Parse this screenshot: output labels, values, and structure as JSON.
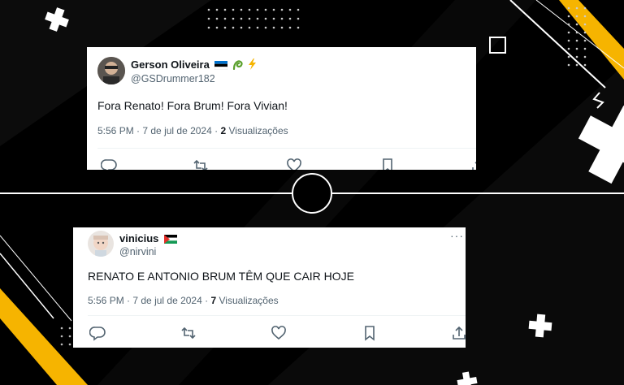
{
  "background": {
    "accent_color": "#f6b400",
    "base_color": "#000000",
    "line_color": "#ffffff"
  },
  "tweets": [
    {
      "author_name": "Gerson Oliveira",
      "author_handle": "@GSDrummer182",
      "author_emojis": [
        "estonia-flag",
        "green-swirl",
        "lightning"
      ],
      "text": "Fora Renato! Fora Brum! Fora Vivian!",
      "time": "5:56 PM",
      "date": "7 de jul de 2024",
      "views_count": "2",
      "views_label": "Visualizações"
    },
    {
      "author_name": "vinicius",
      "author_handle": "@nirvini",
      "author_emojis": [
        "palestine-flag"
      ],
      "text": "RENATO E ANTONIO BRUM TÊM QUE CAIR HOJE",
      "time": "5:56 PM",
      "date": "7 de jul de 2024",
      "views_count": "7",
      "views_label": "Visualizações"
    }
  ]
}
